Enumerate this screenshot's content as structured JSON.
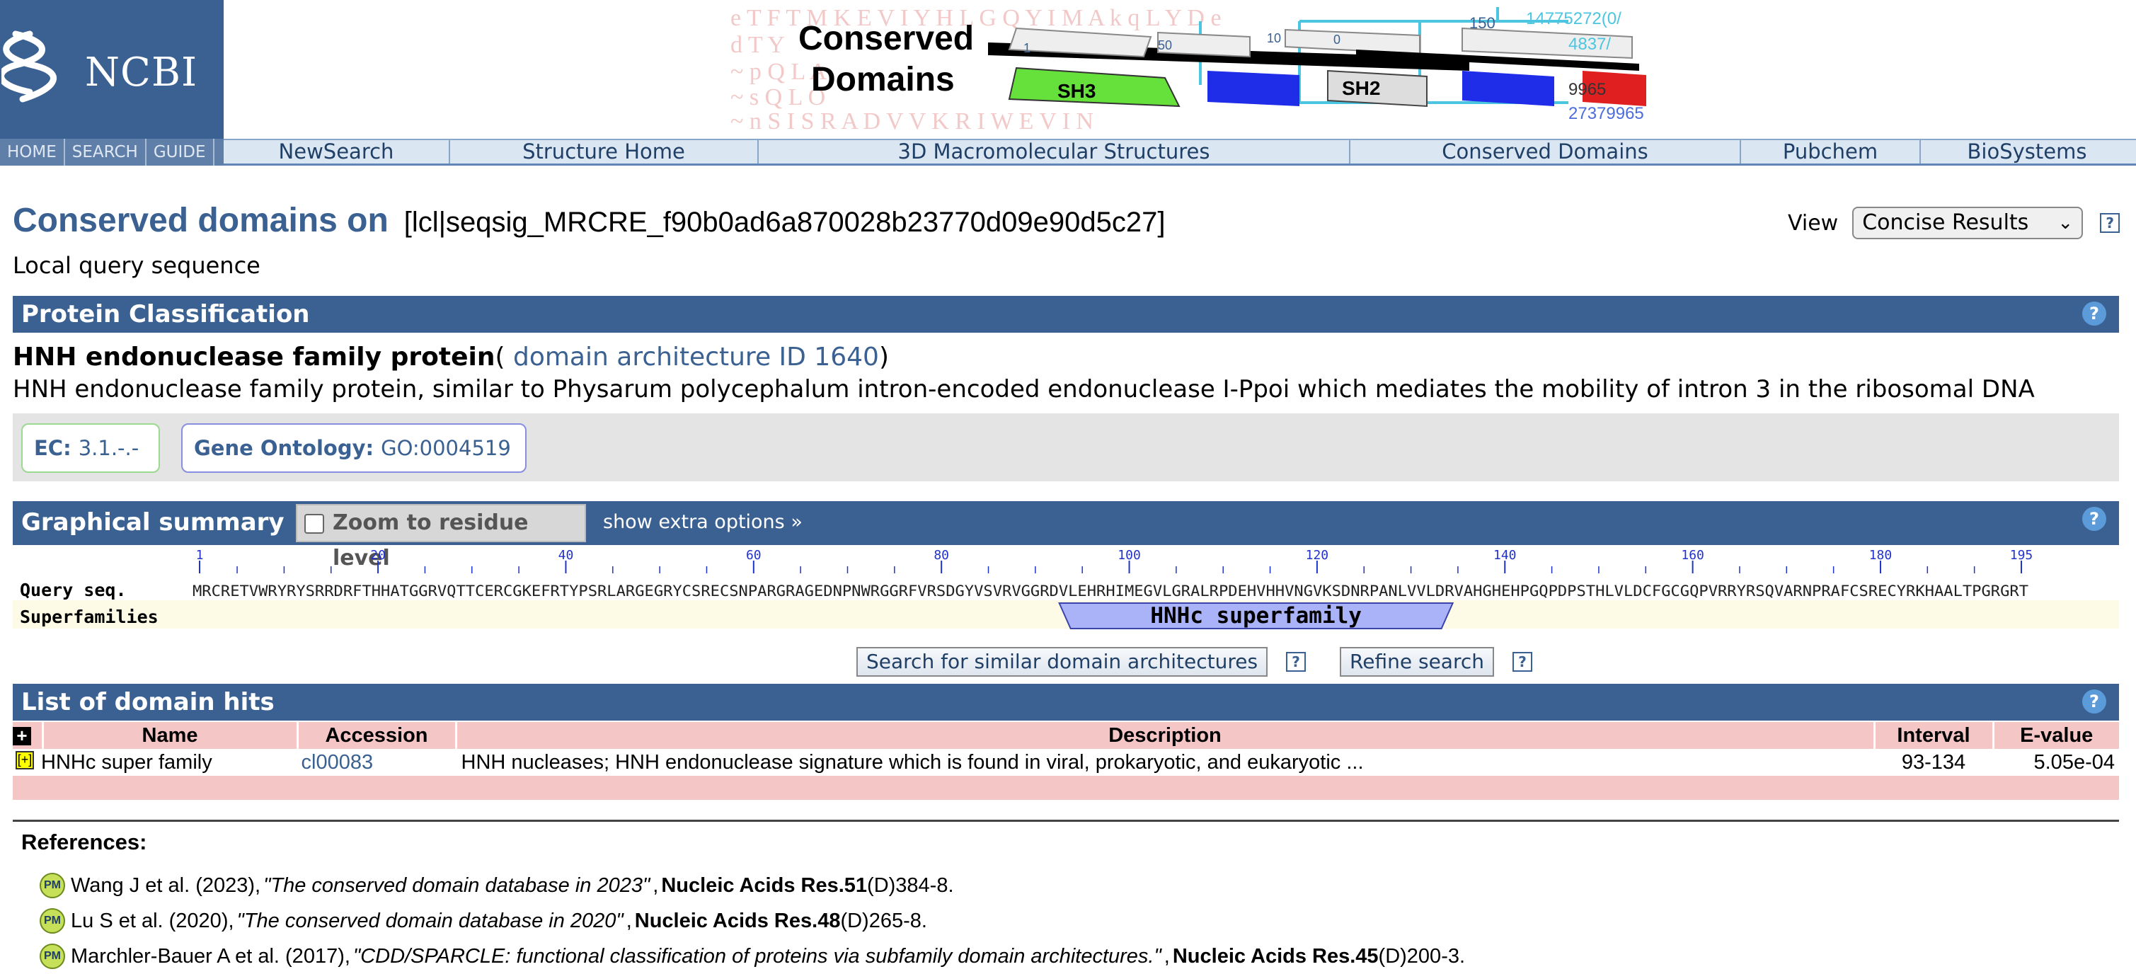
{
  "header": {
    "logo_text": "NCBI",
    "mini_links": [
      "HOME",
      "SEARCH",
      "GUIDE"
    ],
    "banner": {
      "title_line1": "Conserved",
      "title_line2": "Domains",
      "domain_labels": [
        "SH3",
        "SH2"
      ],
      "ruler_numbers": [
        "1",
        "50",
        "10",
        "0",
        "150"
      ],
      "id_numbers": [
        "14775272(0/",
        "4837/",
        "9965",
        "27379965"
      ],
      "bg_sequence": [
        "e T F T M K E V I Y H L G Q Y I M A k q L Y D e",
        "d T Y",
        "~ p Q L A",
        "~ s Q L O",
        "~ n S I S R A D V V K R I W E V I N"
      ]
    },
    "nav": [
      "NewSearch",
      "Structure Home",
      "3D Macromolecular Structures",
      "Conserved Domains",
      "Pubchem",
      "BioSystems"
    ]
  },
  "page": {
    "title": "Conserved domains on",
    "query_id": "[lcl|seqsig_MRCRE_f90b0ad6a870028b23770d09e90d5c27]",
    "subtitle": "Local query sequence",
    "view_label": "View",
    "view_selected": "Concise Results",
    "help_glyph": "?"
  },
  "protein_classification": {
    "section_title": "Protein Classification",
    "name": "HNH endonuclease family protein",
    "paren_open": "(",
    "arch_link": " domain architecture ID 1640",
    "paren_close": ")",
    "description": "HNH endonuclease family protein, similar to Physarum polycephalum intron-encoded endonuclease I-Ppoi which mediates the mobility of intron 3 in the ribosomal DNA",
    "ec_label": "EC:",
    "ec_value": "3.1.-.-",
    "go_label": "Gene Ontology:",
    "go_value": "GO:0004519"
  },
  "graphical_summary": {
    "section_title": "Graphical summary",
    "zoom_label": "Zoom to residue level",
    "zoom_checked": false,
    "extra_options": "show extra options »",
    "query_label": "Query seq.",
    "superfamilies_label": "Superfamilies",
    "ruler_ticks": [
      1,
      20,
      40,
      60,
      80,
      100,
      120,
      140,
      160,
      180,
      195
    ],
    "sequence": "MRCRETVWRYRYSRRDRFTHHATGGRVQTTCERCGKEFRTYPSRLARGEGRYCSRECSNPARGRAGEDNPNWRGGRFVRSDGYVSVRVGGRDVLEHRHIMEGVLGRALRPDEHVHHVNGVKSDNRPANLVVLDRVAHGHEHPGQPDPSTHLVLDCFGCGQPVRRYRSQVARNPRAFCSRECYRKHAALTPGRGRT",
    "sequence_length": 195,
    "domain_label": "HNHc superfamily",
    "domain_start": 93,
    "domain_end": 134,
    "domain_color": "#aab2f8"
  },
  "buttons": {
    "search_similar": "Search for similar domain architectures",
    "refine": "Refine search"
  },
  "domain_hits": {
    "section_title": "List of domain hits",
    "columns": [
      "Name",
      "Accession",
      "Description",
      "Interval",
      "E-value"
    ],
    "rows": [
      {
        "expand": "+",
        "name": "HNHc super family",
        "accession": "cl00083",
        "description": "HNH nucleases; HNH endonuclease signature which is found in viral, prokaryotic, and eukaryotic ...",
        "interval": "93-134",
        "evalue": "5.05e-04"
      }
    ]
  },
  "references": {
    "title": "References:",
    "items": [
      {
        "authors": "Wang J et al. (2023),",
        "title": "\"The conserved domain database in 2023\"",
        "journal": "Nucleic Acids Res.51",
        "pages": "(D)384-8."
      },
      {
        "authors": "Lu S et al. (2020),",
        "title": "\"The conserved domain database in 2020\"",
        "journal": "Nucleic Acids Res.48",
        "pages": "(D)265-8."
      },
      {
        "authors": "Marchler-Bauer A et al. (2017),",
        "title": "\"CDD/SPARCLE: functional classification of proteins via subfamily domain architectures.\"",
        "journal": "Nucleic Acids Res.45",
        "pages": "(D)200-3."
      }
    ]
  },
  "colors": {
    "ncbi_blue": "#3a6191",
    "header_pink": "#f5c6c6",
    "ruler_blue": "#2233cc"
  }
}
